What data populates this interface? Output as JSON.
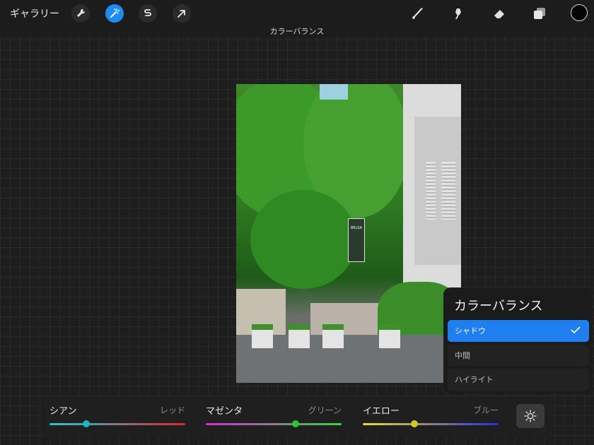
{
  "topbar": {
    "gallery_label": "ギャラリー",
    "left_tools": [
      {
        "icon": "wrench-icon",
        "active": false
      },
      {
        "icon": "magic-wand-icon",
        "active": true
      },
      {
        "icon": "selection-s-icon",
        "active": false
      },
      {
        "icon": "arrow-cursor-icon",
        "active": false
      }
    ],
    "right_tools": [
      "brush-icon",
      "smudge-icon",
      "eraser-icon",
      "layers-icon"
    ],
    "current_color": "#050505",
    "accent_color": "#1f8bf3"
  },
  "adjustment_title": "カラーバランス",
  "canvas": {
    "sign_text": "BELSA"
  },
  "panel": {
    "title": "カラーバランス",
    "options": [
      {
        "label": "シャドウ",
        "selected": true
      },
      {
        "label": "中間",
        "selected": false
      },
      {
        "label": "ハイライト",
        "selected": false
      }
    ]
  },
  "sliders": [
    {
      "left": "シアン",
      "right": "レッド",
      "value": 0.27,
      "from": "#22c7d6",
      "to": "#e0262a"
    },
    {
      "left": "マゼンタ",
      "right": "グリーン",
      "value": 0.66,
      "from": "#d62ad0",
      "to": "#34d83a"
    },
    {
      "left": "イエロー",
      "right": "ブルー",
      "value": 0.38,
      "from": "#e8e02a",
      "to": "#2a2ae0"
    }
  ],
  "brightness_icon": "sun-icon"
}
